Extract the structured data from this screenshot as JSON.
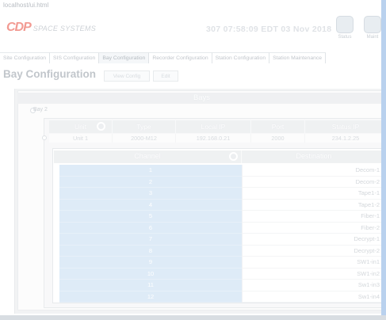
{
  "topbar": {
    "url": "localhost/ui.html"
  },
  "header": {
    "logo_mark": "CDP",
    "logo_text": "SPACE SYSTEMS",
    "clock": "307  07:58:09 EDT  03 Nov 2018",
    "status_label": "Status",
    "maint_label": "Maint"
  },
  "tabs": [
    {
      "label": "Site Configuration"
    },
    {
      "label": "SIS Configuration"
    },
    {
      "label": "Bay Configuration"
    },
    {
      "label": "Recorder Configuration"
    },
    {
      "label": "Station Configuration"
    },
    {
      "label": "Station Maintenance"
    }
  ],
  "page": {
    "title": "Bay Configuration",
    "btn_view_config": "View Config",
    "btn_edit": "Edit"
  },
  "bays": {
    "header": "Bays",
    "bay_label": "Bay 2",
    "unit_columns": [
      "Unit",
      "Type",
      "Local IP",
      "Port",
      "Status IP"
    ],
    "unit_row": [
      "Unit 1",
      "2000-M12",
      "192.168.0.21",
      "2000",
      "234.1.2.25"
    ],
    "channel_header": "Channel",
    "destination_header": "Destination",
    "channels": [
      {
        "num": "1",
        "dest": "Decom-1"
      },
      {
        "num": "2",
        "dest": "Decom-2"
      },
      {
        "num": "3",
        "dest": "Tape1-1"
      },
      {
        "num": "4",
        "dest": "Tape1-2"
      },
      {
        "num": "5",
        "dest": "Fiber-1"
      },
      {
        "num": "6",
        "dest": "Fiber-2"
      },
      {
        "num": "7",
        "dest": "Decrypt-1"
      },
      {
        "num": "8",
        "dest": "Decrypt-2"
      },
      {
        "num": "9",
        "dest": "SW1-in1"
      },
      {
        "num": "10",
        "dest": "SW1-in2"
      },
      {
        "num": "11",
        "dest": "Sw1-in3"
      },
      {
        "num": "12",
        "dest": "Sw1-in4"
      }
    ]
  }
}
